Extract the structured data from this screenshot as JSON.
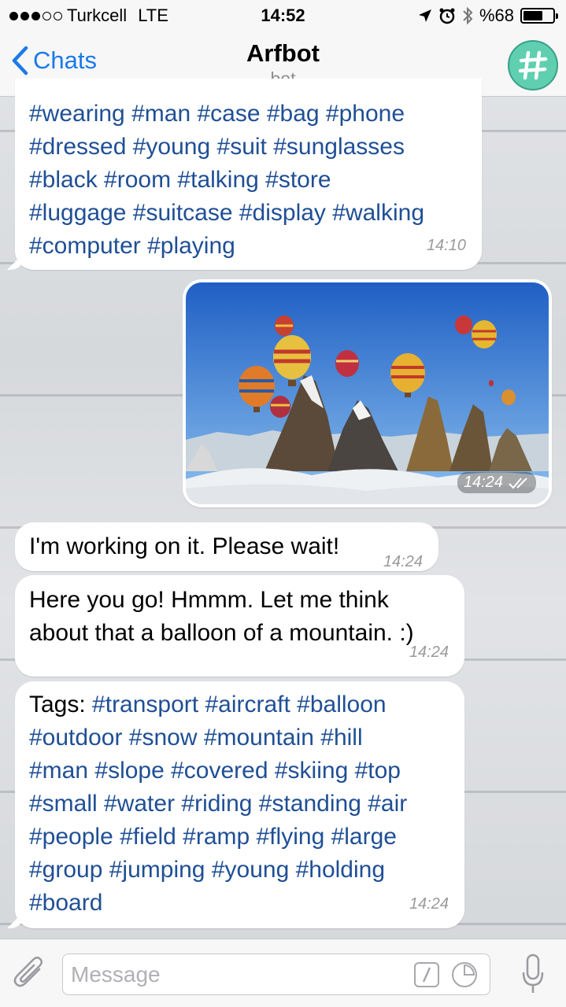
{
  "status": {
    "carrier": "Turkcell",
    "network": "LTE",
    "time": "14:52",
    "battery": "%68",
    "battery_level": 0.68
  },
  "nav": {
    "back_label": "Chats",
    "title": "Arfbot",
    "subtitle": "bot",
    "avatar_icon": "hashtag-icon"
  },
  "messages": [
    {
      "lines": [
        "#wearing #man #case #bag #phone",
        "#dressed #young #suit #sunglasses",
        "#black #room #talking #store",
        "#luggage #suitcase #display #walking",
        "#computer #playing"
      ],
      "time": "14:10"
    },
    {
      "type": "photo",
      "time": "14:24",
      "status_icon": "double-check-icon"
    },
    {
      "text": "I'm working on it. Please wait!",
      "time": "14:24"
    },
    {
      "lines": [
        "Here you go! Hmmm. Let me think",
        "about that a balloon of a mountain. :)"
      ],
      "time": "14:24"
    },
    {
      "prefix": "Tags: ",
      "lines": [
        "#transport #aircraft #balloon",
        "#outdoor #snow #mountain #hill",
        "#man #slope #covered #skiing #top",
        "#small #water #riding #standing #air",
        "#people #field #ramp #flying #large",
        "#group #jumping #young #holding",
        "#board"
      ],
      "time": "14:24"
    }
  ],
  "input": {
    "placeholder": "Message"
  },
  "colors": {
    "accent": "#1a7ae8",
    "tag": "#1f4f95",
    "avatar": "#5fcfb0"
  }
}
